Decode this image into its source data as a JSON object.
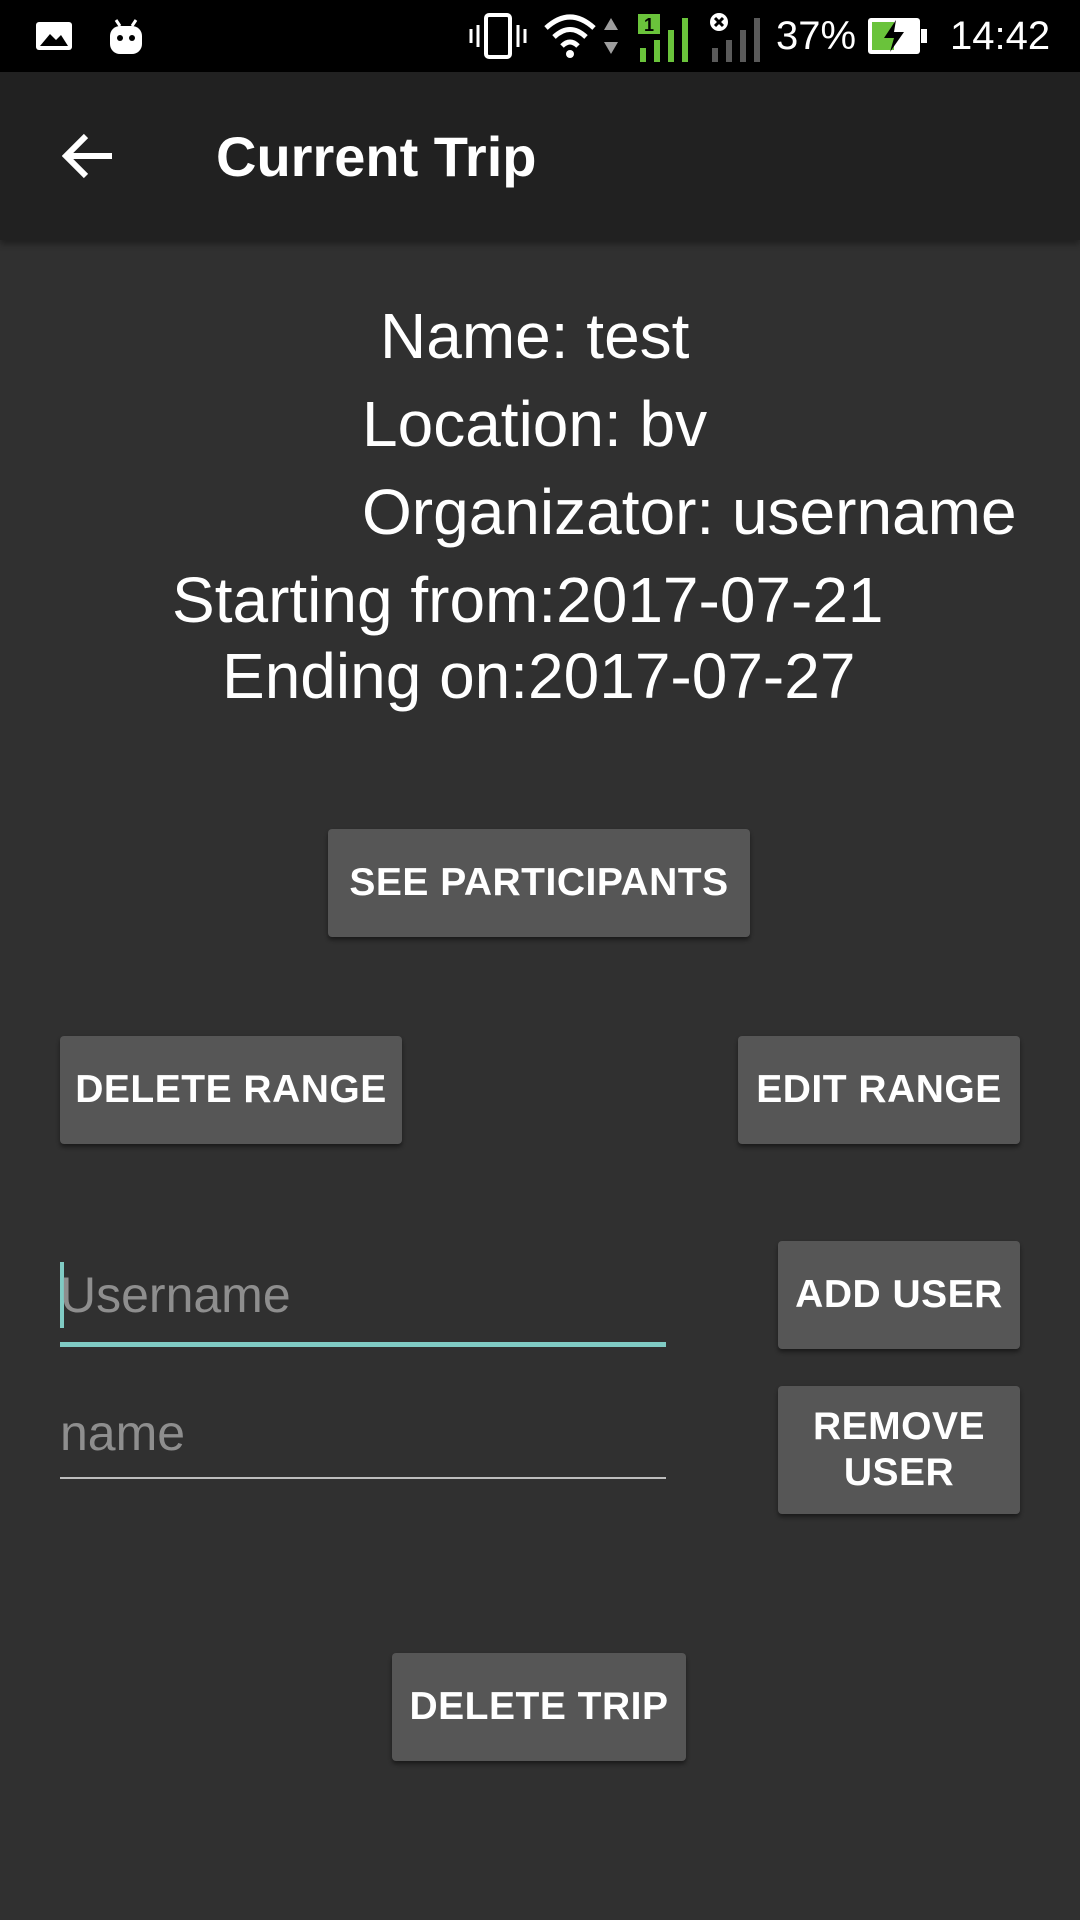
{
  "status_bar": {
    "battery_percent": "37%",
    "time": "14:42",
    "sim_badge": "1",
    "icons": [
      "gallery-icon",
      "android-icon",
      "vibrate-icon",
      "wifi-icon",
      "data-arrows-icon",
      "signal-icon",
      "no-signal-icon",
      "battery-charging-icon"
    ],
    "colors": {
      "signal_active": "#6ac33b",
      "battery_fill": "#6ac33b"
    }
  },
  "app_bar": {
    "title": "Current Trip",
    "back_icon": "arrow-back-icon"
  },
  "trip": {
    "name": "Name: test",
    "location": "Location: bv",
    "organizator": "Organizator: username",
    "starting": "Starting from:2017-07-21",
    "ending": "Ending on:2017-07-27"
  },
  "buttons": {
    "see_participants": "SEE PARTICIPANTS",
    "delete_range": "DELETE RANGE",
    "edit_range": "EDIT RANGE",
    "add_user": "ADD USER",
    "remove_user": "REMOVE USER",
    "delete_trip": "DELETE TRIP"
  },
  "inputs": {
    "username": {
      "placeholder": "Username",
      "value": ""
    },
    "name": {
      "placeholder": "name",
      "value": ""
    }
  },
  "colors": {
    "background": "#303030",
    "app_bar": "#212121",
    "button": "#565656",
    "accent": "#80cbc4",
    "placeholder": "#8e8e8e"
  }
}
